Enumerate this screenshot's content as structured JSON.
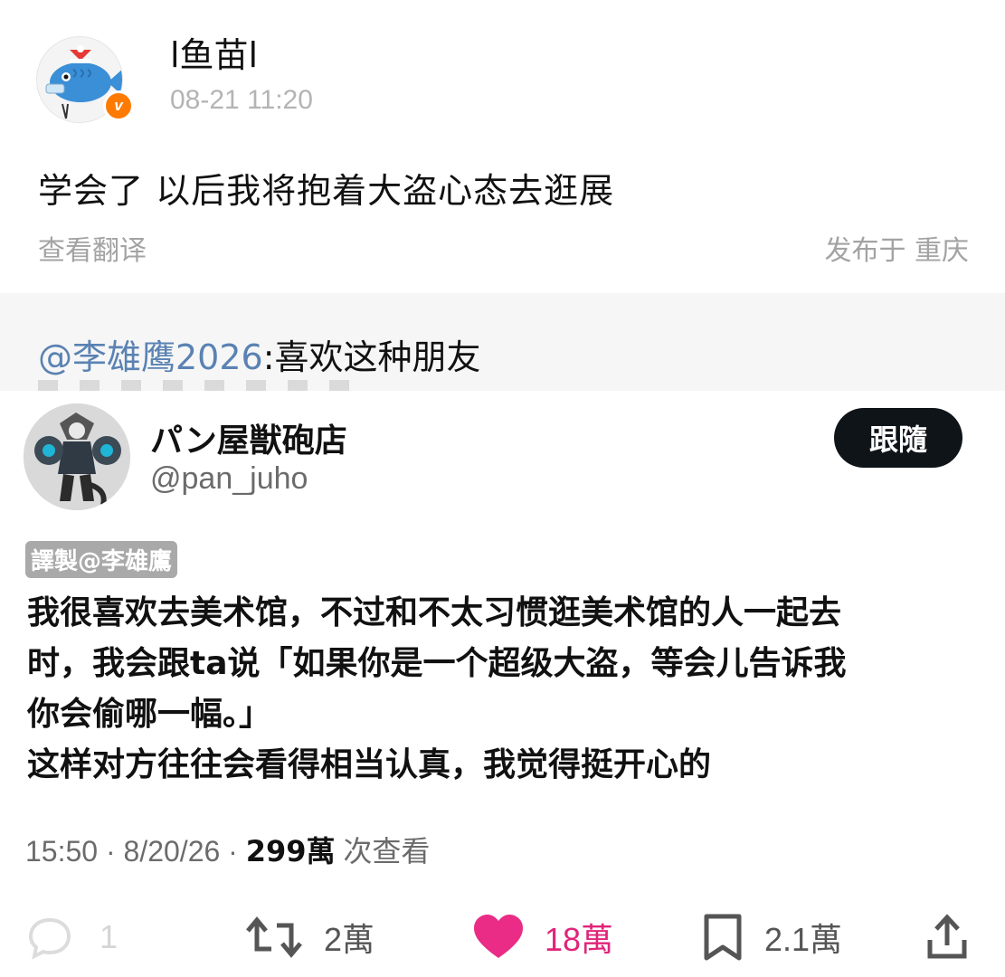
{
  "weibo_post": {
    "author_name": "l鱼苗l",
    "verified_badge": "v",
    "timestamp": "08-21 11:20",
    "text": "学会了 以后我将抱着大盗心态去逛展",
    "translate_link": "查看翻译",
    "location": "发布于 重庆",
    "repost_comment": {
      "mention": "@李雄鹰2026",
      "separator": ":",
      "text": "喜欢这种朋友"
    }
  },
  "tweet": {
    "display_name": "パン屋獣砲店",
    "handle": "@pan_juho",
    "follow_label": "跟隨",
    "translator_watermark": "譯製@李雄鷹",
    "body_lines": [
      "我很喜欢去美术馆，不过和不太习惯逛美术馆的人一起去",
      "时，我会跟ta说「如果你是一个超级大盗，等会儿告诉我",
      "你会偷哪一幅。」",
      "这样对方往往会看得相当认真，我觉得挺开心的"
    ],
    "meta": {
      "time": "15:50",
      "date": "8/20/26",
      "views_count": "299萬",
      "views_label": "次查看"
    },
    "actions": {
      "reply_count": "1",
      "retweet_count": "2萬",
      "like_count": "18萬",
      "bookmark_count": "2.1萬"
    }
  },
  "icons": {
    "reply": "comment-bubble-icon",
    "retweet": "retweet-icon",
    "like": "heart-icon",
    "bookmark": "bookmark-icon",
    "share": "share-icon"
  },
  "colors": {
    "mention_blue": "#5a82b3",
    "like_pink": "#e0247a",
    "verified_orange": "#ff7a00",
    "follow_button_bg": "#0f1419"
  }
}
